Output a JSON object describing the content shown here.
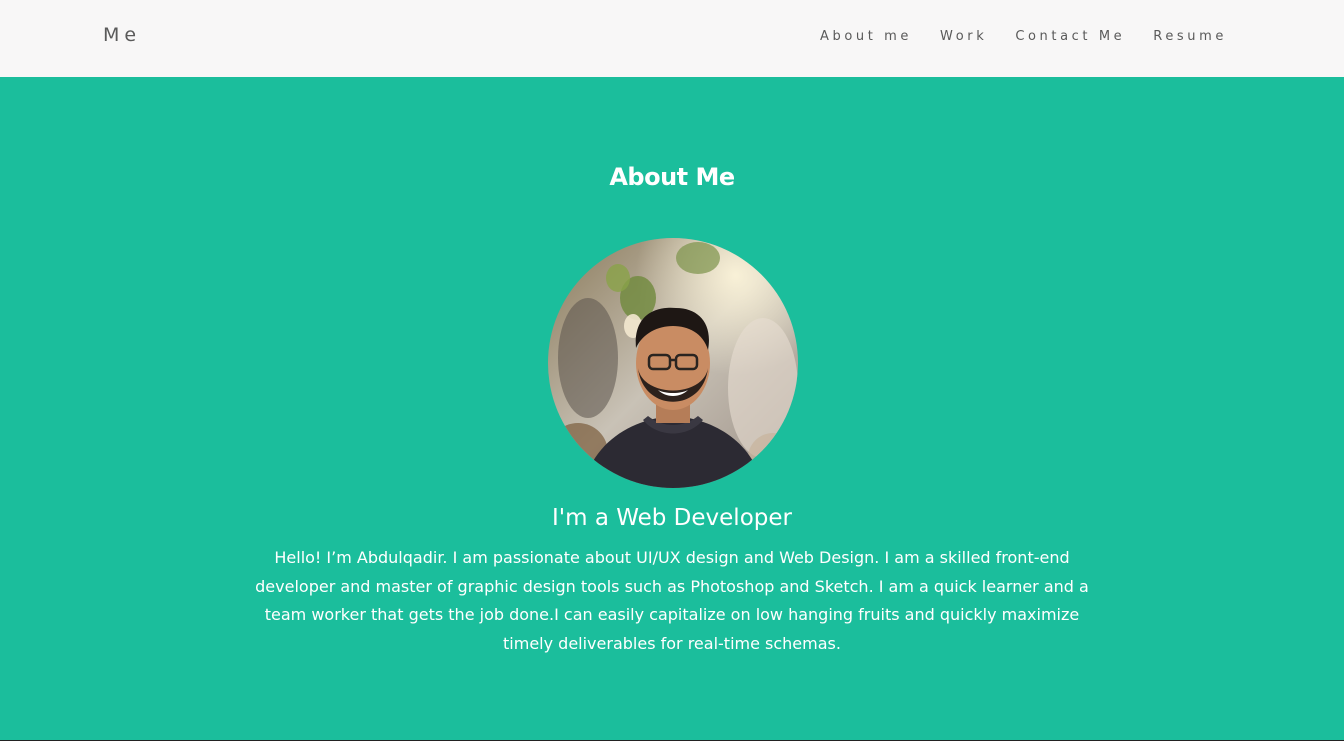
{
  "header": {
    "brand": "Me",
    "nav": [
      {
        "label": "About me"
      },
      {
        "label": "Work"
      },
      {
        "label": "Contact Me"
      },
      {
        "label": "Resume"
      }
    ]
  },
  "about": {
    "title": "About Me",
    "subtitle": "I'm a Web Developer",
    "bio": "Hello! I’m Abdulqadir. I am passionate about UI/UX design and Web Design. I am a skilled front-end developer and master of graphic design tools such as Photoshop and Sketch. I am a quick learner and a team worker that gets the job done.I can easily capitalize on low hanging fruits and quickly maximize timely deliverables for real-time schemas."
  },
  "colors": {
    "accent": "#1bbe9c",
    "navbar_bg": "#f8f7f7",
    "nav_text": "#5a5a5a"
  }
}
